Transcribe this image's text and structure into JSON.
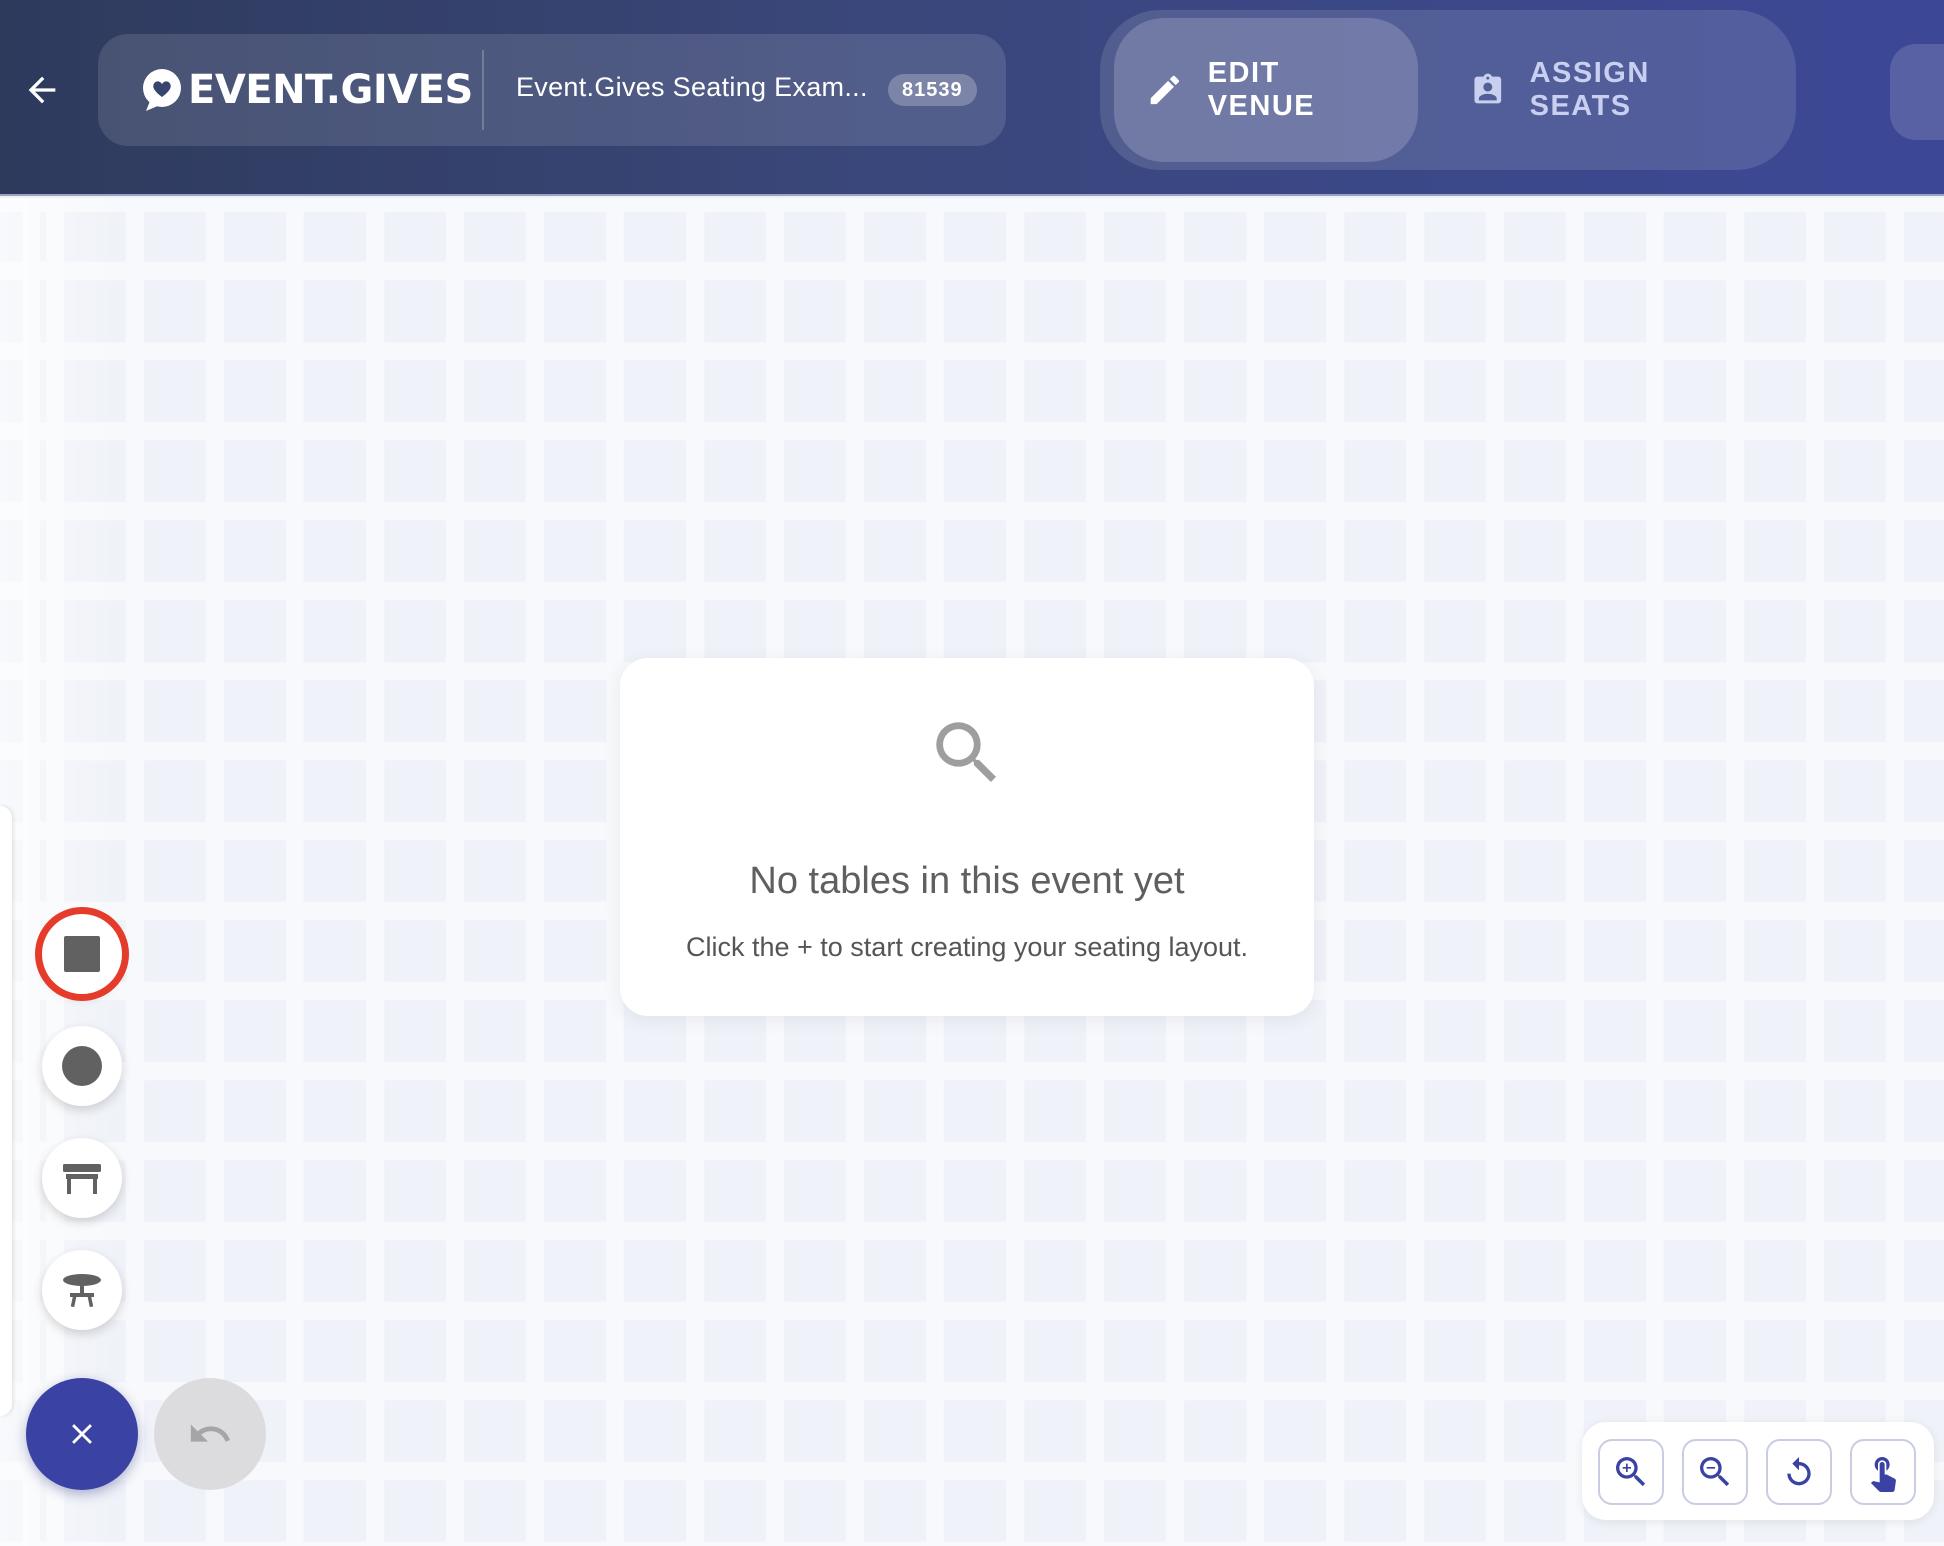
{
  "header": {
    "brand_name": "EVENT.GIVES",
    "event_title": "Event.Gives Seating Exam...",
    "event_id": "81539",
    "tabs": [
      {
        "label": "EDIT VENUE",
        "icon": "pencil-icon",
        "active": true
      },
      {
        "label": "ASSIGN SEATS",
        "icon": "badge-icon",
        "active": false
      }
    ]
  },
  "empty_state": {
    "icon": "search-icon",
    "title": "No tables in this event yet",
    "subtitle": "Click the + to start creating your seating layout."
  },
  "tools": [
    {
      "name": "square-table-tool",
      "icon": "square-icon",
      "highlighted": true
    },
    {
      "name": "round-table-tool",
      "icon": "circle-icon",
      "highlighted": false
    },
    {
      "name": "banquet-table-tool",
      "icon": "rect-table-icon",
      "highlighted": false
    },
    {
      "name": "cocktail-table-tool",
      "icon": "cocktail-table-icon",
      "highlighted": false
    }
  ],
  "fab": {
    "close_icon": "close-icon",
    "undo_icon": "undo-icon"
  },
  "zoom_controls": [
    "zoom-in-icon",
    "zoom-out-icon",
    "reset-icon",
    "pan-hand-icon"
  ],
  "colors": {
    "header_start": "#2e3a5c",
    "header_end": "#3c4896",
    "accent": "#3a43a4",
    "highlight_ring": "#e53b2b",
    "canvas": "#f7f8fb"
  }
}
